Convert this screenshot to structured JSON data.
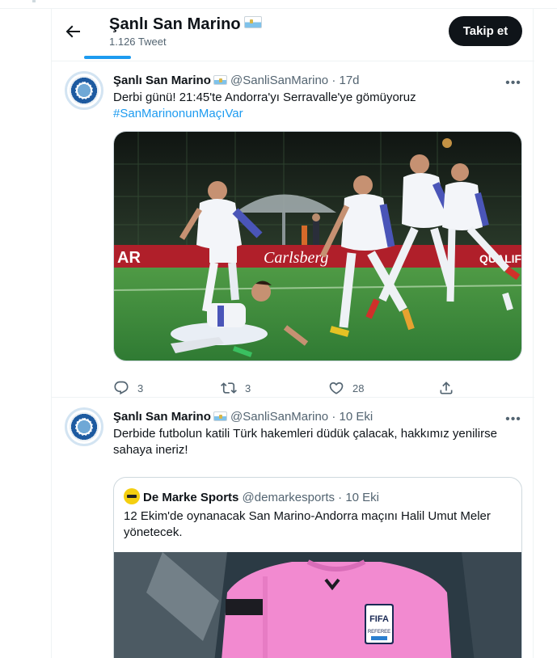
{
  "header": {
    "back_icon": "arrow-left-icon",
    "title": "Şanlı San Marino",
    "flag_icon": "san-marino-flag-icon",
    "subtitle": "1.126 Tweet",
    "follow_label": "Takip et"
  },
  "tweets": [
    {
      "name": "Şanlı San Marino",
      "handle": "@SanliSanMarino",
      "sep": "·",
      "time": "17d",
      "text": "Derbi günü! 21:45'te Andorra'yı Serravalle'ye gömüyoruz",
      "hashtag": "#SanMarinonunMaçıVar",
      "media_board_left": "AR",
      "media_board_center": "Carlsberg",
      "media_board_right": "QUALIF",
      "replies": "3",
      "retweets": "3",
      "likes": "28"
    },
    {
      "name": "Şanlı San Marino",
      "handle": "@SanliSanMarino",
      "sep": "·",
      "time": "10 Eki",
      "text_line1": "Derbide futbolun katili Türk hakemleri düdük çalacak, hakkımız yenilirse",
      "text_line2": "sahaya ineriz!",
      "quote": {
        "name": "De Marke Sports",
        "handle": "@demarkesports",
        "sep": "·",
        "time": "10 Eki",
        "text_line1": "12 Ekim'de oynanacak San Marino-Andorra maçını Halil Umut Meler",
        "text_line2": "yönetecek.",
        "badge_top": "FIFA",
        "badge_bottom": "REFEREE"
      }
    }
  ],
  "colors": {
    "accent": "#1d9bf0",
    "text": "#0f1419",
    "secondary": "#536471",
    "border": "#eff3f4",
    "pitch": "#3f8a3a",
    "kit": "#4a55b8",
    "referee_shirt": "#f28ad0"
  }
}
